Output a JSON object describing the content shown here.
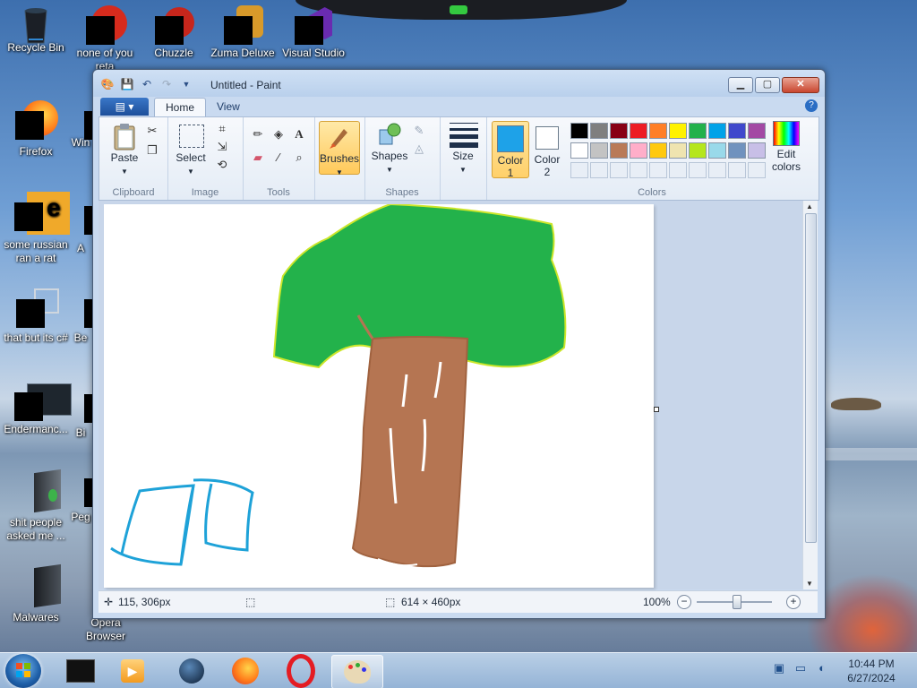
{
  "desktop": {
    "icons": [
      {
        "label": "Recycle Bin"
      },
      {
        "label": "none of you reta"
      },
      {
        "label": "Chuzzle"
      },
      {
        "label": "Zuma Deluxe"
      },
      {
        "label": "Visual Studio"
      },
      {
        "label": "Firefox"
      },
      {
        "label": "Win"
      },
      {
        "label": "some russian ran a rat"
      },
      {
        "label": "A"
      },
      {
        "label": "that but its c#"
      },
      {
        "label": "Be"
      },
      {
        "label": "Endermanc..."
      },
      {
        "label": "Bi"
      },
      {
        "label": "shit people asked me ..."
      },
      {
        "label": "Peg"
      },
      {
        "label": "Malwares"
      },
      {
        "label": "Opera Browser"
      }
    ]
  },
  "window": {
    "title": "Untitled - Paint",
    "buttons": {
      "minimize": "▁",
      "maximize": "▢",
      "close": "✕"
    }
  },
  "ribbon": {
    "tabs": [
      "Home",
      "View"
    ],
    "help": "?",
    "groups": {
      "clipboard": {
        "label": "Clipboard",
        "paste": "Paste"
      },
      "image": {
        "label": "Image",
        "select": "Select"
      },
      "tools": {
        "label": "Tools"
      },
      "brushes": {
        "label": "Brushes"
      },
      "shapes": {
        "label": "Shapes",
        "shapes_btn": "Shapes"
      },
      "size": {
        "label": "Size"
      },
      "colors": {
        "label": "Colors",
        "color1": "Color",
        "color1_num": "1",
        "color2": "Color",
        "color2_num": "2",
        "edit_colors": "Edit colors",
        "color1_value": "#1ea2e8",
        "color2_value": "#ffffff",
        "palette_row1": [
          "#000000",
          "#7f7f7f",
          "#880015",
          "#ed1c24",
          "#ff7f27",
          "#fff200",
          "#22b14c",
          "#00a2e8",
          "#3f48cc",
          "#a349a4"
        ],
        "palette_row2": [
          "#ffffff",
          "#c3c3c3",
          "#b97a57",
          "#ffaec9",
          "#ffc90e",
          "#efe4b0",
          "#b5e61d",
          "#99d9ea",
          "#7092be",
          "#c8bfe7"
        ]
      }
    }
  },
  "statusbar": {
    "cursor_pos": "115, 306px",
    "image_size": "614 × 460px",
    "zoom": "100%"
  },
  "taskbar": {
    "clock_time": "10:44 PM",
    "clock_date": "6/27/2024"
  }
}
